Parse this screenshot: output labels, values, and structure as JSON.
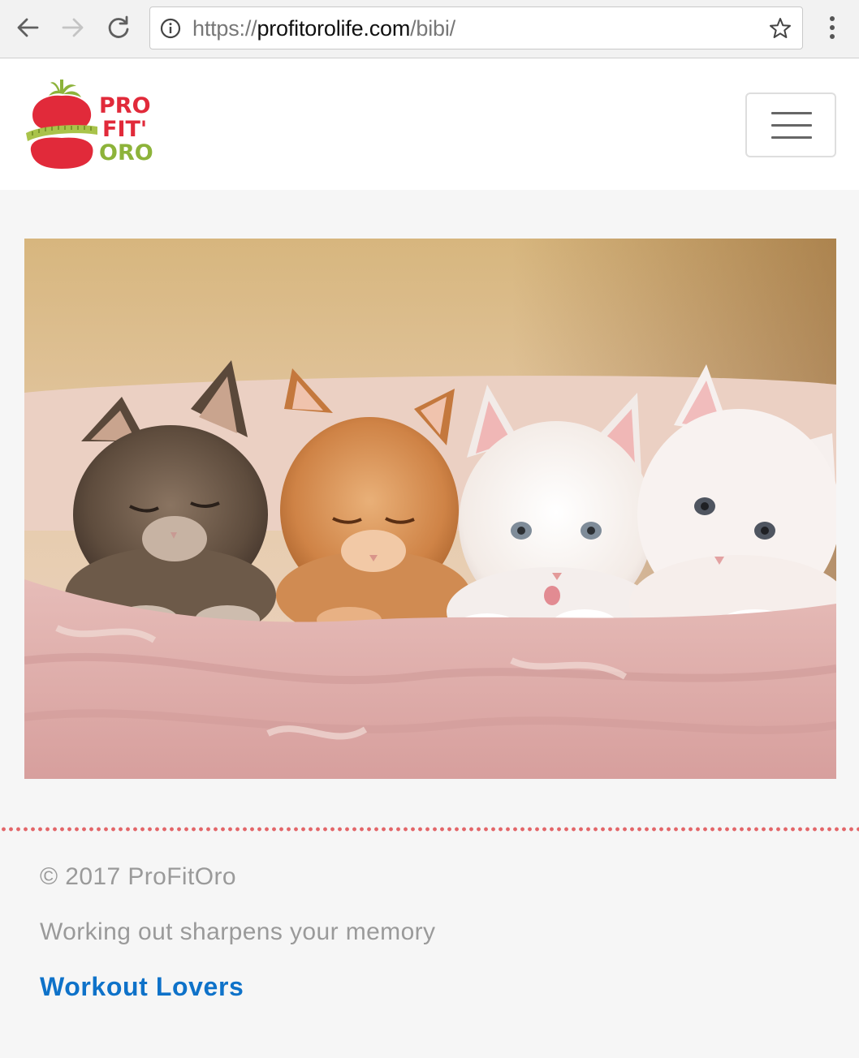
{
  "browser": {
    "url_scheme": "https://",
    "url_host": "profitorolife.com",
    "url_path": "/bibi/"
  },
  "header": {
    "logo_words": [
      "PRO",
      "FIT'",
      "ORO"
    ],
    "logo_colors": {
      "red": "#e12a3a",
      "green": "#8db33a"
    },
    "menu_icon": "hamburger-menu-icon"
  },
  "main": {
    "image_subject": "four-kittens-on-pink-blanket"
  },
  "footer": {
    "copyright": "© 2017 ProFitOro",
    "tagline": "Working out sharpens your memory",
    "link_label": "Workout Lovers",
    "divider_color": "#e3676a",
    "link_color": "#0e72c9"
  }
}
